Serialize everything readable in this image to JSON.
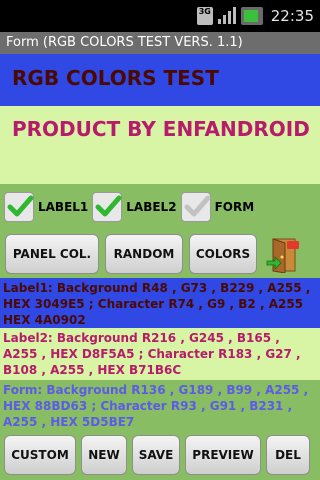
{
  "status_bar": {
    "network": "3G",
    "time": "22:35"
  },
  "title_bar": {
    "title": "Form (RGB COLORS TEST VERS. 1.1)"
  },
  "header": {
    "line1": "RGB COLORS TEST",
    "line2": "PRODUCT BY ENFANDROID"
  },
  "checkboxes": [
    {
      "label": "LABEL1",
      "checked": true
    },
    {
      "label": "LABEL2",
      "checked": true
    },
    {
      "label": "FORM",
      "checked": false
    }
  ],
  "buttons_top": {
    "panel_col": "PANEL COL.",
    "random": "RANDOM",
    "colors": "COLORS",
    "exit_icon_text": "EXIT"
  },
  "info": {
    "label1": "Label1: Background R48 , G73 , B229 , A255 , HEX 3049E5 ; Character R74 , G9 , B2 , A255 HEX 4A0902",
    "label2": "Label2: Background R216 , G245 , B165 , A255 , HEX D8F5A5 ; Character R183 , G27 , B108 , A255 , HEX B71B6C",
    "form": "Form: Background R136 , G189 , B99 , A255 , HEX 88BD63  ; Character R93 , G91 , B231 , A255 , HEX 5D5BE7"
  },
  "buttons_bottom": {
    "custom": "CUSTOM",
    "new": "NEW",
    "save": "SAVE",
    "preview": "PREVIEW",
    "del": "DEL"
  },
  "colors": {
    "label1_bg": "#3049E5",
    "label1_fg": "#4A0902",
    "label2_bg": "#D8F5A5",
    "label2_fg": "#B71B6C",
    "form_bg": "#88BD63",
    "form_fg": "#5D5BE7"
  }
}
